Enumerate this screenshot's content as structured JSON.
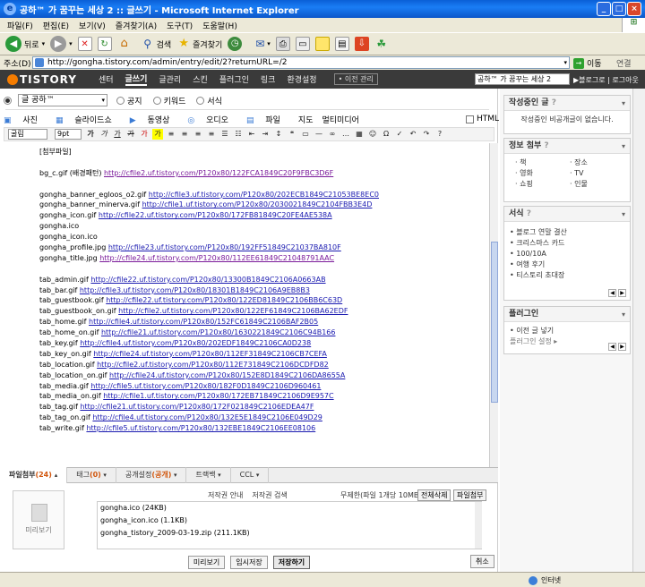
{
  "window": {
    "title": "공하™ 가 꿈꾸는 세상 2 :: 글쓰기 - Microsoft Internet Explorer",
    "min": "_",
    "max": "□",
    "close": "×"
  },
  "menu": [
    "파일(F)",
    "편집(E)",
    "보기(V)",
    "즐겨찾기(A)",
    "도구(T)",
    "도움말(H)"
  ],
  "toolbar": {
    "back": "뒤로",
    "search": "검색",
    "favorites": "즐겨찾기"
  },
  "address": {
    "label": "주소(D)",
    "url": "http://gongha.tistory.com/admin/entry/edit/2?returnURL=/2",
    "go": "이동",
    "links": "연결"
  },
  "tnav": {
    "logo": "TISTORY",
    "items": [
      "센터",
      "글쓰기",
      "글관리",
      "스킨",
      "플러그인",
      "링크",
      "환경설정"
    ],
    "active": 1,
    "prev_mgr": "• 이전 관리",
    "blog_select": "공하™ 가 꿈꾸는 세상 2",
    "right": "▶블로그로 | 로그아웃"
  },
  "editor": {
    "category": "글 공하™",
    "radios": [
      "공지",
      "키워드",
      "서식"
    ],
    "attach": [
      "사진",
      "슬라이드쇼",
      "동영상",
      "오디오",
      "파일",
      "지도",
      "멀티미디어"
    ],
    "html_label": "HTML",
    "font": "굴림",
    "size": "9pt",
    "lines": [
      {
        "t": "[첨부파일]"
      },
      {
        "t": ""
      },
      {
        "t": "bg_c.gif (배경패턴) ",
        "u": "http://cfile2.uf.tistory.com/P120x80/122FCA1849C20F9FBC3D6F"
      },
      {
        "t": ""
      },
      {
        "t": "gongha_banner_egloos_o2.gif ",
        "u": "http://cfile3.uf.tistory.com/P120x80/202ECB1849C21053BE8EC0"
      },
      {
        "t": "gongha_banner_minerva.gif ",
        "u": "http://cfile1.uf.tistory.com/P120x80/2030021849C2104FBB3E4D"
      },
      {
        "t": "gongha_icon.gif ",
        "u": "http://cfile22.uf.tistory.com/P120x80/172FB81849C20FE4AE538A"
      },
      {
        "t": "gongha.ico"
      },
      {
        "t": "gongha_icon.ico"
      },
      {
        "t": "gongha_profile.jpg ",
        "u": "http://cfile23.uf.tistory.com/P120x80/192FF51849C21037BA810F"
      },
      {
        "t": "gongha_title.jpg ",
        "u": "http://cfile24.uf.tistory.com/P120x80/112EE61849C21048791AAC"
      },
      {
        "t": ""
      },
      {
        "t": "tab_admin.gif ",
        "u": "http://cfile22.uf.tistory.com/P120x80/13300B1849C2106A0663AB"
      },
      {
        "t": "tab_bar.gif ",
        "u": "http://cfile3.uf.tistory.com/P120x80/18301B1849C2106A9EB8B3"
      },
      {
        "t": "tab_guestbook.gif ",
        "u": "http://cfile22.uf.tistory.com/P120x80/122ED81849C2106BB6C63D"
      },
      {
        "t": "tab_guestbook_on.gif ",
        "u": "http://cfile2.uf.tistory.com/P120x80/122EF61849C2106BA62EDF"
      },
      {
        "t": "tab_home.gif ",
        "u": "http://cfile4.uf.tistory.com/P120x80/152FC61849C2106BAF2B05"
      },
      {
        "t": "tab_home_on.gif ",
        "u": "http://cfile21.uf.tistory.com/P120x80/1630221849C2106C94B166"
      },
      {
        "t": "tab_key.gif ",
        "u": "http://cfile4.uf.tistory.com/P120x80/202EDF1849C2106CA0D238"
      },
      {
        "t": "tab_key_on.gif ",
        "u": "http://cfile24.uf.tistory.com/P120x80/112EF31849C2106CB7CEFA"
      },
      {
        "t": "tab_location.gif ",
        "u": "http://cfile2.uf.tistory.com/P120x80/112E731849C2106DCDFD82"
      },
      {
        "t": "tab_location_on.gif ",
        "u": "http://cfile24.uf.tistory.com/P120x80/152E8D1849C2106DA8655A"
      },
      {
        "t": "tab_media.gif ",
        "u": "http://cfile5.uf.tistory.com/P120x80/182F0D1849C2106D960461"
      },
      {
        "t": "tab_media_on.gif ",
        "u": "http://cfile1.uf.tistory.com/P120x80/172EB71849C2106D9E957C"
      },
      {
        "t": "tab_tag.gif ",
        "u": "http://cfile21.uf.tistory.com/P120x80/172F021849C2106EDEA47F"
      },
      {
        "t": "tab_tag_on.gif ",
        "u": "http://cfile4.uf.tistory.com/P120x80/132E5E1849C2106E049D29"
      },
      {
        "t": "tab_write.gif ",
        "u": "http://cfile5.uf.tistory.com/P120x80/132EBE1849C2106EE08106"
      }
    ]
  },
  "tabs": [
    {
      "label": "파일첨부",
      "num": "(24)"
    },
    {
      "label": "태그",
      "num": "(0)"
    },
    {
      "label": "공개설정",
      "num": "(공개)"
    },
    {
      "label": "트랙백",
      "num": ""
    },
    {
      "label": "CCL",
      "num": ""
    }
  ],
  "files": {
    "preview": "미리보기",
    "copyright": "저작권 안내",
    "copyright_search": "저작권 검색",
    "limit": "무제한(파일 1개당 10MB)",
    "delete_all": "전체삭제",
    "attach": "파일첨부",
    "items": [
      "gongha.ico (24KB)",
      "gongha_icon.ico (1.1KB)",
      "gongha_tistory_2009-03-19.zip (211.1KB)"
    ]
  },
  "buttons": {
    "preview": "미리보기",
    "temp_save": "임시저장",
    "save": "저장하기",
    "cancel": "취소"
  },
  "side": {
    "temp": {
      "title": "작성중인 글",
      "body": "작성중인 비공개글이 없습니다."
    },
    "info": {
      "title": "정보 첨부",
      "items": [
        "책",
        "장소",
        "영화",
        "TV",
        "쇼핑",
        "인물"
      ]
    },
    "forms": {
      "title": "서식",
      "items": [
        "블로그 연말 결산",
        "크리스마스 카드",
        "100/10A",
        "여행 후기",
        "티스토리 초대장"
      ]
    },
    "plugin": {
      "title": "플러그인",
      "item": "이전 글 넣기",
      "setting": "플러그인 설정 ▸"
    }
  },
  "status": {
    "zone": "인터넷"
  }
}
